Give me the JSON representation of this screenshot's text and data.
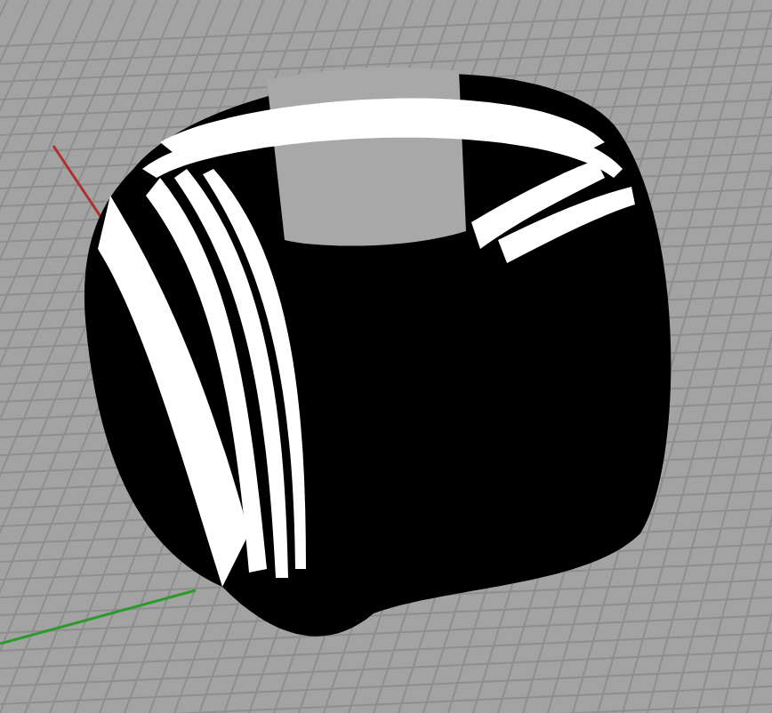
{
  "viewport": {
    "grid": true,
    "axes": true,
    "zebra_stripes": true
  }
}
